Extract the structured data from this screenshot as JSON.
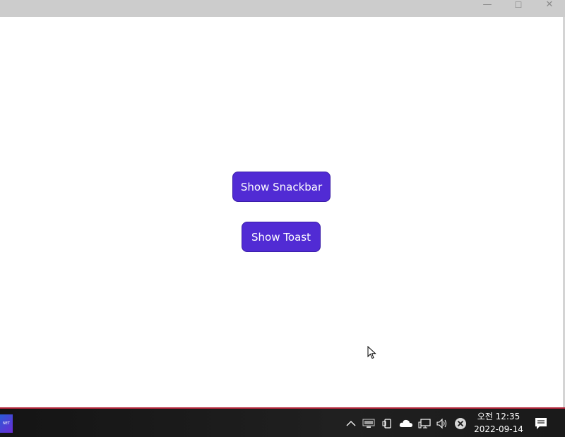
{
  "window": {
    "minimize_glyph": "—",
    "maximize_glyph": "☐",
    "close_glyph": "✕"
  },
  "main": {
    "snackbar_button": "Show Snackbar",
    "toast_button": "Show Toast"
  },
  "taskbar": {
    "app_label": "NET",
    "tray_icons": [
      "chevron-up-icon",
      "monitor-icon",
      "phone-link-icon",
      "onedrive-cloud-icon",
      "network-icon",
      "volume-icon",
      "error-circle-icon"
    ],
    "clock_time": "오전 12:35",
    "clock_date": "2022-09-14"
  },
  "colors": {
    "accent": "#512bd4",
    "titlebar": "#cccccc",
    "taskbar": "#1c1c1c"
  }
}
